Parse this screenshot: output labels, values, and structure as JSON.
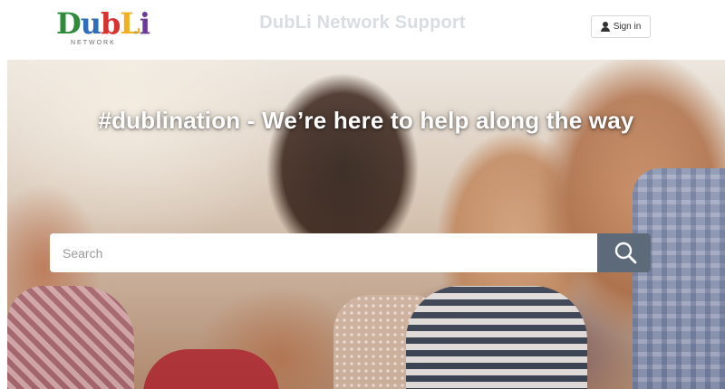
{
  "header": {
    "logo": {
      "letters": [
        {
          "char": "D",
          "color": "#2e8b3a"
        },
        {
          "char": "u",
          "color": "#2e6db8"
        },
        {
          "char": "b",
          "color": "#d8322e"
        },
        {
          "char": "L",
          "color": "#f0b01c"
        },
        {
          "char": "i",
          "color": "#6a3a9a"
        }
      ],
      "subtitle": "NETWORK",
      "trademark": "®"
    },
    "title": "DubLi Network Support",
    "signin_label": "Sign in",
    "signin_icon": "user-icon"
  },
  "hero": {
    "tagline": "#dublination - We’re here to help along the way",
    "search": {
      "placeholder": "Search",
      "value": "",
      "button_icon": "search-icon"
    }
  },
  "colors": {
    "title_text": "#d9dde2",
    "search_button": "#5c6a79",
    "tagline_text": "#ffffff"
  }
}
